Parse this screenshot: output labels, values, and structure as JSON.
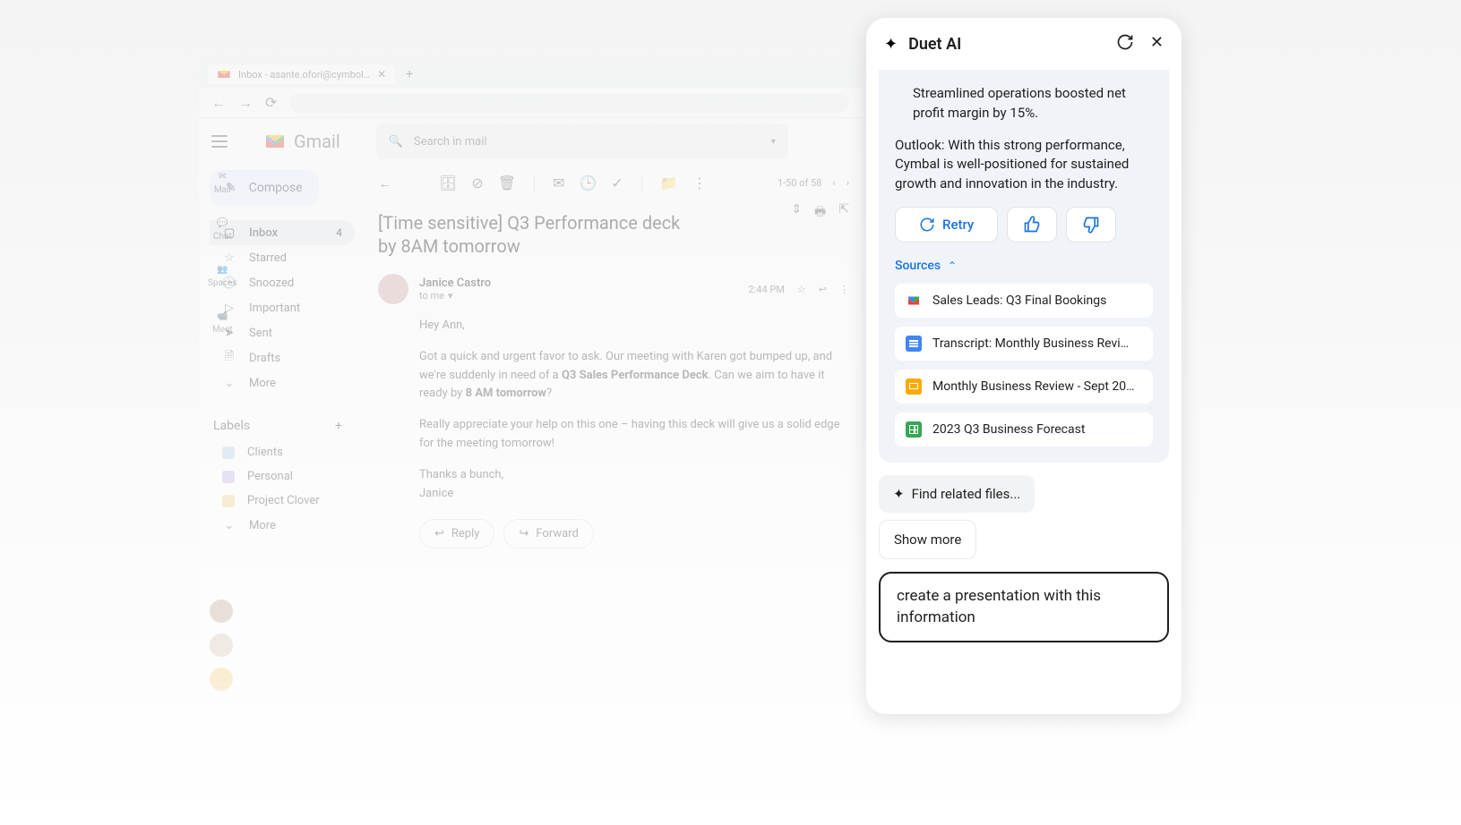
{
  "browser": {
    "tab_title": "Inbox - asante.ofori@cymbol…",
    "tab_add": "+"
  },
  "gmail": {
    "app_name": "Gmail",
    "search_placeholder": "Search in mail",
    "left_nav": {
      "mail": "Mail",
      "chat": "Chat",
      "spaces": "Spaces",
      "meet": "Meet"
    },
    "compose": "Compose",
    "folders": {
      "inbox": "Inbox",
      "inbox_count": "4",
      "starred": "Starred",
      "snoozed": "Snoozed",
      "important": "Important",
      "sent": "Sent",
      "drafts": "Drafts",
      "more": "More"
    },
    "labels": {
      "header": "Labels",
      "clients": "Clients",
      "personal": "Personal",
      "project_clover": "Project Clover",
      "more": "More"
    },
    "pagination": "1-50 of 58",
    "email": {
      "subject": "[Time sensitive] Q3 Performance deck by 8AM tomorrow",
      "sender": "Janice Castro",
      "to": "to me",
      "time": "2:44 PM",
      "greeting": "Hey Ann,",
      "body1_a": "Got a quick and urgent favor to ask. Our meeting with Karen got bumped up, and we're suddenly in need of a ",
      "body1_b": "Q3 Sales Performance Deck",
      "body1_c": ". Can we aim to have it ready by ",
      "body1_d": "8 AM tomorrow",
      "body1_e": "?",
      "body2": "Really appreciate your help on this one – having this deck will give us a solid edge for the meeting tomorrow!",
      "signoff1": "Thanks a bunch,",
      "signoff2": "Janice",
      "reply": "Reply",
      "forward": "Forward"
    }
  },
  "duet": {
    "title": "Duet AI",
    "response": {
      "para1": "Streamlined operations boosted net profit margin by 15%.",
      "para2": "Outlook: With this strong performance, Cymbal is well-positioned for sustained growth and innovation in the industry."
    },
    "retry": "Retry",
    "sources_label": "Sources",
    "sources": {
      "s1": "Sales Leads: Q3 Final Bookings",
      "s2": "Transcript: Monthly Business Revi…",
      "s3": "Monthly Business Review - Sept 20…",
      "s4": "2023 Q3 Business Forecast"
    },
    "suggestion": "Find related files...",
    "show_more": "Show more",
    "prompt_value": "create a presentation with this information"
  },
  "colors": {
    "accent": "#1a73e8",
    "label_clients": "#b3d1e8",
    "label_personal": "#c8b3e8",
    "label_clover": "#f4d58a",
    "src_gmail": "#ea4335",
    "src_docs": "#4285f4",
    "src_slides": "#f9ab00",
    "src_sheets": "#34a853"
  }
}
